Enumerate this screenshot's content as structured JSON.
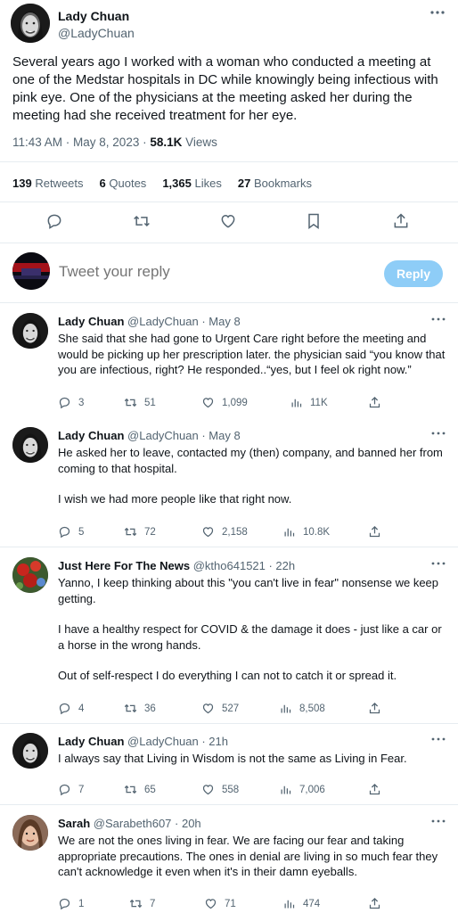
{
  "main_tweet": {
    "author_name": "Lady Chuan",
    "author_handle": "@LadyChuan",
    "text": "Several years ago I worked with a woman who conducted a meeting at one of the Medstar hospitals in DC while knowingly being infectious with pink eye. One of the physicians at the meeting asked her during the meeting had she received treatment for her eye.",
    "time": "11:43 AM · May 8, 2023 · ",
    "views_count": "58.1K",
    "views_label": " Views",
    "stats": {
      "retweets_count": "139",
      "retweets_label": "Retweets",
      "quotes_count": "6",
      "quotes_label": "Quotes",
      "likes_count": "1,365",
      "likes_label": "Likes",
      "bookmarks_count": "27",
      "bookmarks_label": "Bookmarks"
    },
    "icons": [
      "reply-icon",
      "retweet-icon",
      "like-icon",
      "bookmark-icon",
      "share-icon"
    ]
  },
  "reply_box": {
    "placeholder": "Tweet your reply",
    "button_label": "Reply",
    "button_color": "#8ecdf7"
  },
  "replies": [
    {
      "name": "Lady Chuan",
      "handle": "@LadyChuan · May 8",
      "paragraphs": [
        "She said that she had gone to Urgent Care right before the meeting and would be picking up her prescription later. the physician said “you know that you are infectious, right? He responded..“yes, but I feel ok right now.”"
      ],
      "replies": "3",
      "retweets": "51",
      "likes": "1,099",
      "views": "11K"
    },
    {
      "name": "Lady Chuan",
      "handle": "@LadyChuan · May 8",
      "paragraphs": [
        "He asked her to leave, contacted my (then) company, and banned her from coming to that hospital.",
        "I wish we had more people like that right now."
      ],
      "replies": "5",
      "retweets": "72",
      "likes": "2,158",
      "views": "10.8K"
    },
    {
      "name": "Just Here For The News",
      "handle": "@ktho641521 · 22h",
      "paragraphs": [
        "Yanno, I keep thinking about this \"you can't live in fear\" nonsense we keep getting.",
        "I have a healthy respect for COVID & the damage it does - just like a car or a horse in the wrong hands.",
        "Out of self-respect I do everything I can not to catch it or spread it."
      ],
      "replies": "4",
      "retweets": "36",
      "likes": "527",
      "views": "8,508"
    },
    {
      "name": "Lady Chuan",
      "handle": "@LadyChuan · 21h",
      "paragraphs": [
        "I always say that Living in Wisdom is not the same as Living in Fear."
      ],
      "replies": "7",
      "retweets": "65",
      "likes": "558",
      "views": "7,006"
    },
    {
      "name": "Sarah",
      "handle": "@Sarabeth607 · 20h",
      "paragraphs": [
        "We are not the ones living in fear. We are facing our fear and taking appropriate precautions. The ones in denial are living in so much fear they can't acknowledge it even when it's in their damn eyeballs."
      ],
      "replies": "1",
      "retweets": "7",
      "likes": "71",
      "views": "474"
    }
  ]
}
